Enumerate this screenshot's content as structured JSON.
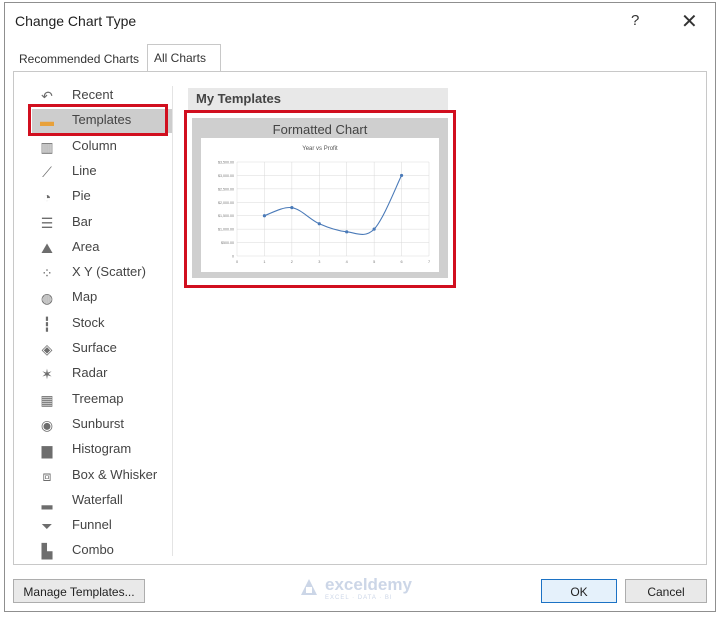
{
  "dialog": {
    "title": "Change Chart Type",
    "help": "?",
    "close": "✕"
  },
  "tabs": [
    {
      "label": "Recommended Charts"
    },
    {
      "label": "All Charts"
    }
  ],
  "sidebar": {
    "items": [
      {
        "label": "Recent",
        "icon": "recent-icon",
        "glyph": "↶"
      },
      {
        "label": "Templates",
        "icon": "templates-folder-icon",
        "glyph": "▬",
        "selected": true
      },
      {
        "label": "Column",
        "icon": "column-chart-icon",
        "glyph": "▥"
      },
      {
        "label": "Line",
        "icon": "line-chart-icon",
        "glyph": "⟋"
      },
      {
        "label": "Pie",
        "icon": "pie-chart-icon",
        "glyph": "◔"
      },
      {
        "label": "Bar",
        "icon": "bar-chart-icon",
        "glyph": "☰"
      },
      {
        "label": "Area",
        "icon": "area-chart-icon",
        "glyph": "⛰"
      },
      {
        "label": "X Y (Scatter)",
        "icon": "scatter-chart-icon",
        "glyph": "⁘"
      },
      {
        "label": "Map",
        "icon": "map-chart-icon",
        "glyph": "◍"
      },
      {
        "label": "Stock",
        "icon": "stock-chart-icon",
        "glyph": "┇"
      },
      {
        "label": "Surface",
        "icon": "surface-chart-icon",
        "glyph": "◈"
      },
      {
        "label": "Radar",
        "icon": "radar-chart-icon",
        "glyph": "✶"
      },
      {
        "label": "Treemap",
        "icon": "treemap-chart-icon",
        "glyph": "▦"
      },
      {
        "label": "Sunburst",
        "icon": "sunburst-chart-icon",
        "glyph": "◉"
      },
      {
        "label": "Histogram",
        "icon": "histogram-chart-icon",
        "glyph": "▆"
      },
      {
        "label": "Box & Whisker",
        "icon": "box-whisker-chart-icon",
        "glyph": "⧈"
      },
      {
        "label": "Waterfall",
        "icon": "waterfall-chart-icon",
        "glyph": "▂"
      },
      {
        "label": "Funnel",
        "icon": "funnel-chart-icon",
        "glyph": "⏷"
      },
      {
        "label": "Combo",
        "icon": "combo-chart-icon",
        "glyph": "▙"
      }
    ]
  },
  "templates": {
    "section_title": "My Templates",
    "template_name": "Formatted Chart"
  },
  "chart_data": {
    "type": "line",
    "title": "Year vs Profit",
    "xlabel": "",
    "ylabel": "",
    "x": [
      1,
      2,
      3,
      4,
      5,
      6
    ],
    "series": [
      {
        "values": [
          1500,
          1800,
          1200,
          900,
          1000,
          3000
        ]
      }
    ],
    "xticks": [
      "0",
      "1",
      "2",
      "3",
      "4",
      "5",
      "6",
      "7"
    ],
    "yticks": [
      "0",
      "$500.00",
      "$1,000.00",
      "$1,500.00",
      "$2,000.00",
      "$2,500.00",
      "$3,000.00",
      "$3,500.00"
    ],
    "xlim": [
      0,
      7
    ],
    "ylim": [
      0,
      3500
    ],
    "smooth": true,
    "grid": true,
    "colors": {
      "line": "#4a7ab8",
      "grid": "#d9d9d9"
    }
  },
  "footer": {
    "manage_label": "Manage Templates...",
    "ok_label": "OK",
    "cancel_label": "Cancel"
  },
  "watermark": {
    "name": "exceldemy",
    "tagline": "EXCEL · DATA · BI"
  },
  "colors": {
    "highlight": "#d10f1f",
    "selected_bg": "#cdcdcd",
    "accent": "#1c72c4"
  }
}
